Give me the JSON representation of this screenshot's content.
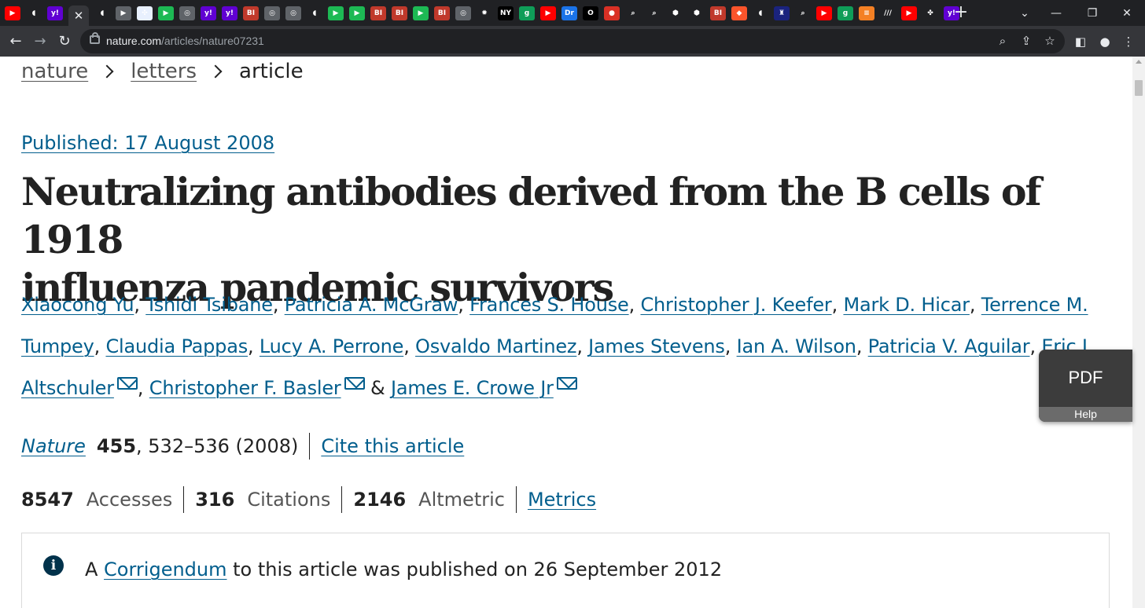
{
  "browser": {
    "tabs": [
      {
        "icon": "youtube-icon",
        "text": "▶",
        "bg": "#ff0000"
      },
      {
        "icon": "shield-tab-icon",
        "text": "◖",
        "bg": "#202124"
      },
      {
        "icon": "yahoo-icon",
        "text": "y!",
        "bg": "#6001d2"
      },
      {
        "icon": "close-tab-icon",
        "text": "✕",
        "bg": "#35363a",
        "active": true
      },
      {
        "icon": "shield-tab-icon",
        "text": "◖",
        "bg": "#202124"
      },
      {
        "icon": "flag-icon",
        "text": "▶",
        "bg": "#5f6368"
      },
      {
        "icon": "puzzle-icon",
        "text": "✣",
        "bg": "#e8f0fe"
      },
      {
        "icon": "play-green-icon",
        "text": "▶",
        "bg": "#1db954"
      },
      {
        "icon": "globe-icon",
        "text": "◎",
        "bg": "#5f6368"
      },
      {
        "icon": "yahoo-icon",
        "text": "y!",
        "bg": "#6001d2"
      },
      {
        "icon": "yahoo-icon",
        "text": "y!",
        "bg": "#6001d2"
      },
      {
        "icon": "bi-icon",
        "text": "BI",
        "bg": "#c0392b"
      },
      {
        "icon": "globe-icon",
        "text": "◎",
        "bg": "#5f6368"
      },
      {
        "icon": "globe-icon",
        "text": "◎",
        "bg": "#5f6368"
      },
      {
        "icon": "shield-tab-icon",
        "text": "◖",
        "bg": "#202124"
      },
      {
        "icon": "play-green-icon",
        "text": "▶",
        "bg": "#1db954"
      },
      {
        "icon": "play-green-icon",
        "text": "▶",
        "bg": "#1db954"
      },
      {
        "icon": "bi-icon",
        "text": "BI",
        "bg": "#c0392b"
      },
      {
        "icon": "bi-icon",
        "text": "BI",
        "bg": "#c0392b"
      },
      {
        "icon": "play-green-icon",
        "text": "▶",
        "bg": "#1db954"
      },
      {
        "icon": "bi-icon",
        "text": "BI",
        "bg": "#c0392b"
      },
      {
        "icon": "globe-icon",
        "text": "◎",
        "bg": "#5f6368"
      },
      {
        "icon": "burst-icon",
        "text": "✹",
        "bg": "#202124"
      },
      {
        "icon": "news-icon",
        "text": "NY",
        "bg": "#000000"
      },
      {
        "icon": "g-icon",
        "text": "g",
        "bg": "#0f9d58"
      },
      {
        "icon": "youtube-icon",
        "text": "▶",
        "bg": "#ff0000"
      },
      {
        "icon": "dr-icon",
        "text": "Dr",
        "bg": "#1a73e8"
      },
      {
        "icon": "circle-icon",
        "text": "O",
        "bg": "#000000"
      },
      {
        "icon": "mic-icon",
        "text": "●",
        "bg": "#d93025"
      },
      {
        "icon": "search-tab-icon",
        "text": "⌕",
        "bg": "#202124"
      },
      {
        "icon": "search-tab-icon",
        "text": "⌕",
        "bg": "#202124"
      },
      {
        "icon": "hex-icon",
        "text": "⬢",
        "bg": "#202124"
      },
      {
        "icon": "hex-icon",
        "text": "⬢",
        "bg": "#202124"
      },
      {
        "icon": "bi-icon",
        "text": "BI",
        "bg": "#c0392b"
      },
      {
        "icon": "brave-icon",
        "text": "◆",
        "bg": "#fb542b"
      },
      {
        "icon": "shield-tab-icon",
        "text": "◖",
        "bg": "#202124"
      },
      {
        "icon": "crest-icon",
        "text": "♜",
        "bg": "#1a237e"
      },
      {
        "icon": "search-tab-icon",
        "text": "⌕",
        "bg": "#202124"
      },
      {
        "icon": "youtube-icon",
        "text": "▶",
        "bg": "#ff0000"
      },
      {
        "icon": "g-icon",
        "text": "g",
        "bg": "#0f9d58"
      },
      {
        "icon": "stack-icon",
        "text": "≡",
        "bg": "#f48024"
      },
      {
        "icon": "italic-icon",
        "text": "///",
        "bg": "#202124"
      },
      {
        "icon": "youtube-icon",
        "text": "▶",
        "bg": "#ff0000"
      },
      {
        "icon": "plant-icon",
        "text": "✤",
        "bg": "#202124"
      },
      {
        "icon": "yahoo-icon",
        "text": "y!",
        "bg": "#6001d2"
      }
    ],
    "new_tab": "+",
    "url_host": "nature.com",
    "url_path": "/articles/nature07231"
  },
  "breadcrumb": {
    "items": [
      "nature",
      "letters",
      "article"
    ]
  },
  "article": {
    "published": "Published: 17 August 2008",
    "title_line1": "Neutralizing antibodies derived from the B cells of 1918",
    "title_line2": "influenza pandemic survivors",
    "authors": [
      "Xiaocong Yu",
      "Tshidi Tsibane",
      "Patricia A. McGraw",
      "Frances S. House",
      "Christopher J. Keefer",
      "Mark D. Hicar",
      "Terrence M. Tumpey",
      "Claudia Pappas",
      "Lucy A. Perrone",
      "Osvaldo Martinez",
      "James Stevens",
      "Ian A. Wilson",
      "Patricia V. Aguilar",
      "Eric L. Altschuler",
      "Christopher F. Basler",
      "James E. Crowe Jr"
    ],
    "author_sep": ", ",
    "author_and": " & ",
    "journal": "Nature",
    "volume": "455",
    "pages": ", 532–536 (2008)",
    "cite_label": "Cite this article",
    "metrics": {
      "accesses_value": "8547",
      "accesses_label": "Accesses",
      "citations_value": "316",
      "citations_label": "Citations",
      "altmetric_value": "2146",
      "altmetric_label": "Altmetric",
      "metrics_link": "Metrics"
    },
    "notice": {
      "prefix": "A ",
      "link": "Corrigendum",
      "suffix": " to this article was published on 26 September 2012"
    }
  },
  "widget": {
    "pdf_label": "PDF",
    "help_label": "Help"
  },
  "colors": {
    "link": "#025e8d",
    "text": "#222222",
    "info_icon": "#01324b"
  }
}
